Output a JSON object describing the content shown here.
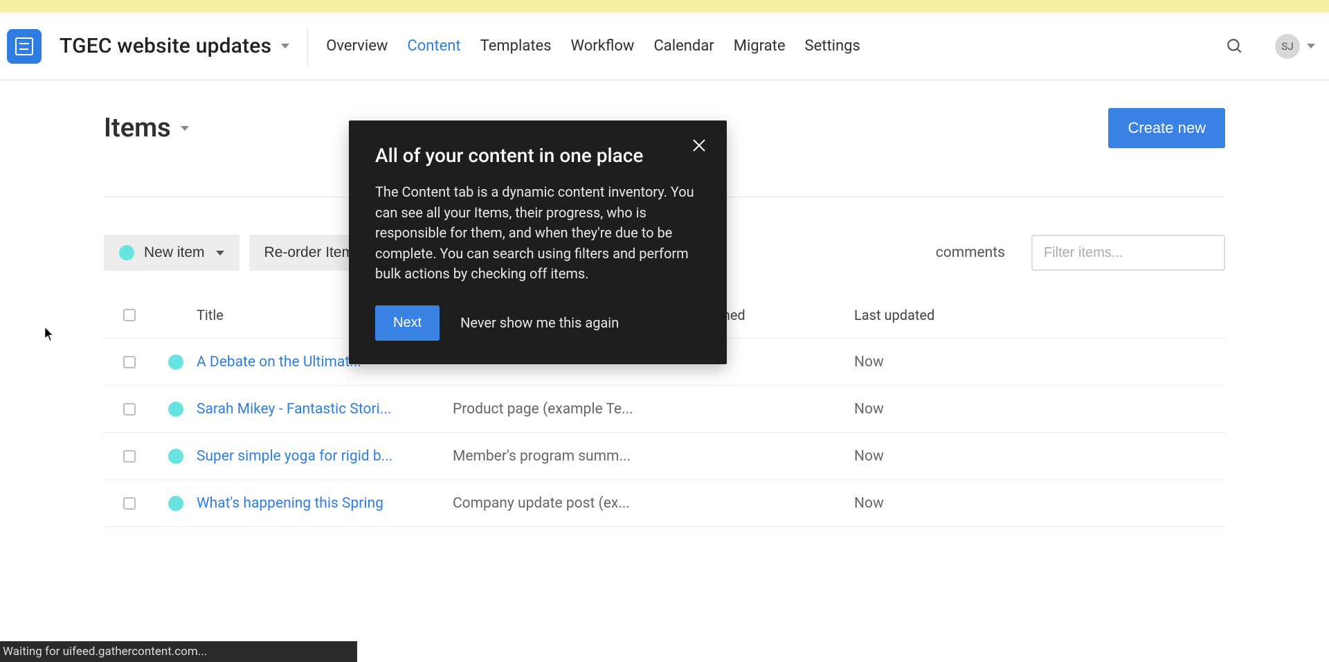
{
  "project_title": "TGEC website updates",
  "nav": {
    "items": [
      "Overview",
      "Content",
      "Templates",
      "Workflow",
      "Calendar",
      "Migrate",
      "Settings"
    ],
    "active": "Content"
  },
  "user": {
    "initials": "SJ"
  },
  "page": {
    "heading": "Items",
    "create_button": "Create new"
  },
  "toolbar": {
    "new_item": "New item",
    "reorder": "Re-order Items",
    "comments_label": "comments",
    "filter_placeholder": "Filter items..."
  },
  "table": {
    "columns": {
      "title": "Title",
      "template": "",
      "assigned": "Assigned",
      "updated": "Last updated"
    },
    "rows": [
      {
        "title": "A Debate on the Ultimat...",
        "template": "",
        "assigned": "",
        "updated": "Now"
      },
      {
        "title": "Sarah Mikey - Fantastic Stori...",
        "template": "Product page (example Te...",
        "assigned": "",
        "updated": "Now"
      },
      {
        "title": "Super simple yoga for rigid b...",
        "template": "Member's program summ...",
        "assigned": "",
        "updated": "Now"
      },
      {
        "title": "What's happening this Spring",
        "template": "Company update post (ex...",
        "assigned": "",
        "updated": "Now"
      }
    ]
  },
  "popover": {
    "title": "All of your content in one place",
    "body": "The Content tab is a dynamic content inventory. You can see all your Items, their progress, who is responsible for them, and when they're due to be complete. You can search using filters and perform bulk actions by checking off items.",
    "next": "Next",
    "never": "Never show me this again"
  },
  "statusbar": "Waiting for uifeed.gathercontent.com..."
}
